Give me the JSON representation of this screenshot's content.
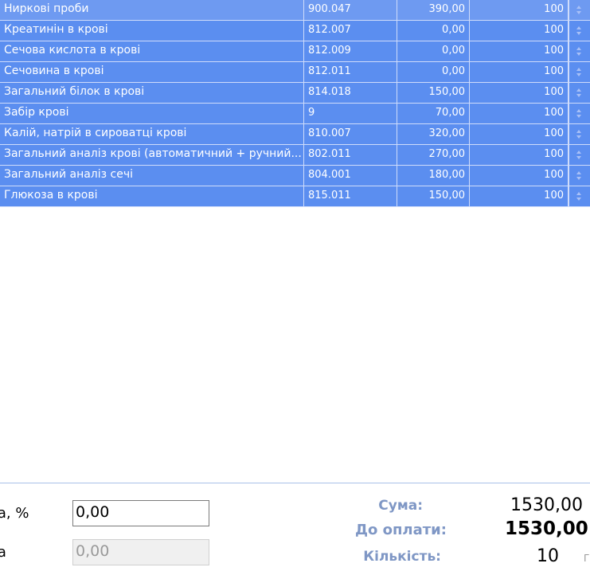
{
  "table": {
    "rows": [
      {
        "name": "Ниркові проби",
        "code": "900.047",
        "price": "390,00",
        "percent": "100"
      },
      {
        "name": "Креатинін в крові",
        "code": "812.007",
        "price": "0,00",
        "percent": "100"
      },
      {
        "name": "Сечова кислота в крові",
        "code": "812.009",
        "price": "0,00",
        "percent": "100"
      },
      {
        "name": "Сечовина в крові",
        "code": "812.011",
        "price": "0,00",
        "percent": "100"
      },
      {
        "name": "Загальний білок в крові",
        "code": "814.018",
        "price": "150,00",
        "percent": "100"
      },
      {
        "name": "Забір крові",
        "code": "9",
        "price": "70,00",
        "percent": "100"
      },
      {
        "name": "Калій, натрій в сироватці крові",
        "code": "810.007",
        "price": "320,00",
        "percent": "100"
      },
      {
        "name": "Загальний аналіз крові (автоматичний + ручний...",
        "code": "802.011",
        "price": "270,00",
        "percent": "100"
      },
      {
        "name": "Загальний аналіз сечі",
        "code": "804.001",
        "price": "180,00",
        "percent": "100"
      },
      {
        "name": "Глюкоза в крові",
        "code": "815.011",
        "price": "150,00",
        "percent": "100"
      }
    ]
  },
  "footer": {
    "discount_label": "ка, %",
    "discount_value": "0,00",
    "bonus_label": "ка",
    "bonus_value": "0,00",
    "sum_label": "Сума:",
    "sum_value": "1530,00",
    "pay_label": "До оплати:",
    "pay_value": "1530,00",
    "qty_label": "Кількість:",
    "qty_value": "10",
    "hint_char": "Г"
  },
  "colors": {
    "row_selected": "#5b8ef0",
    "label_blue": "#7f97c5"
  },
  "icons": {
    "spinner": "spinner-arrows-icon"
  }
}
